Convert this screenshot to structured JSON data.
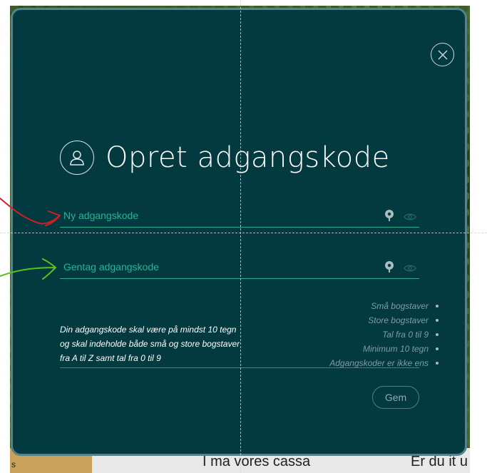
{
  "background": {
    "text_left": "I ma vores cassa",
    "text_right": "Er du it u",
    "edge_text": "s"
  },
  "modal": {
    "title": "Opret adgangskode",
    "fields": [
      {
        "placeholder": "Ny adgangskode",
        "value": ""
      },
      {
        "placeholder": "Gentag adgangskode",
        "value": ""
      }
    ],
    "rules": [
      "Små bogstaver",
      "Store bogstaver",
      "Tal fra 0 til 9",
      "Minimum 10 tegn",
      "Adgangskoder er ikke ens"
    ],
    "info_lines": [
      "Din adgangskode skal være på mindst 10 tegn",
      "og skal indeholde både små og store bogstaver",
      "fra A til Z samt tal fra 0 til 9"
    ],
    "save_label": "Gem"
  },
  "colors": {
    "modal_bg": "#023a40",
    "accent": "#27b496",
    "arrow_red": "#d21f26",
    "arrow_green": "#58c21a"
  }
}
